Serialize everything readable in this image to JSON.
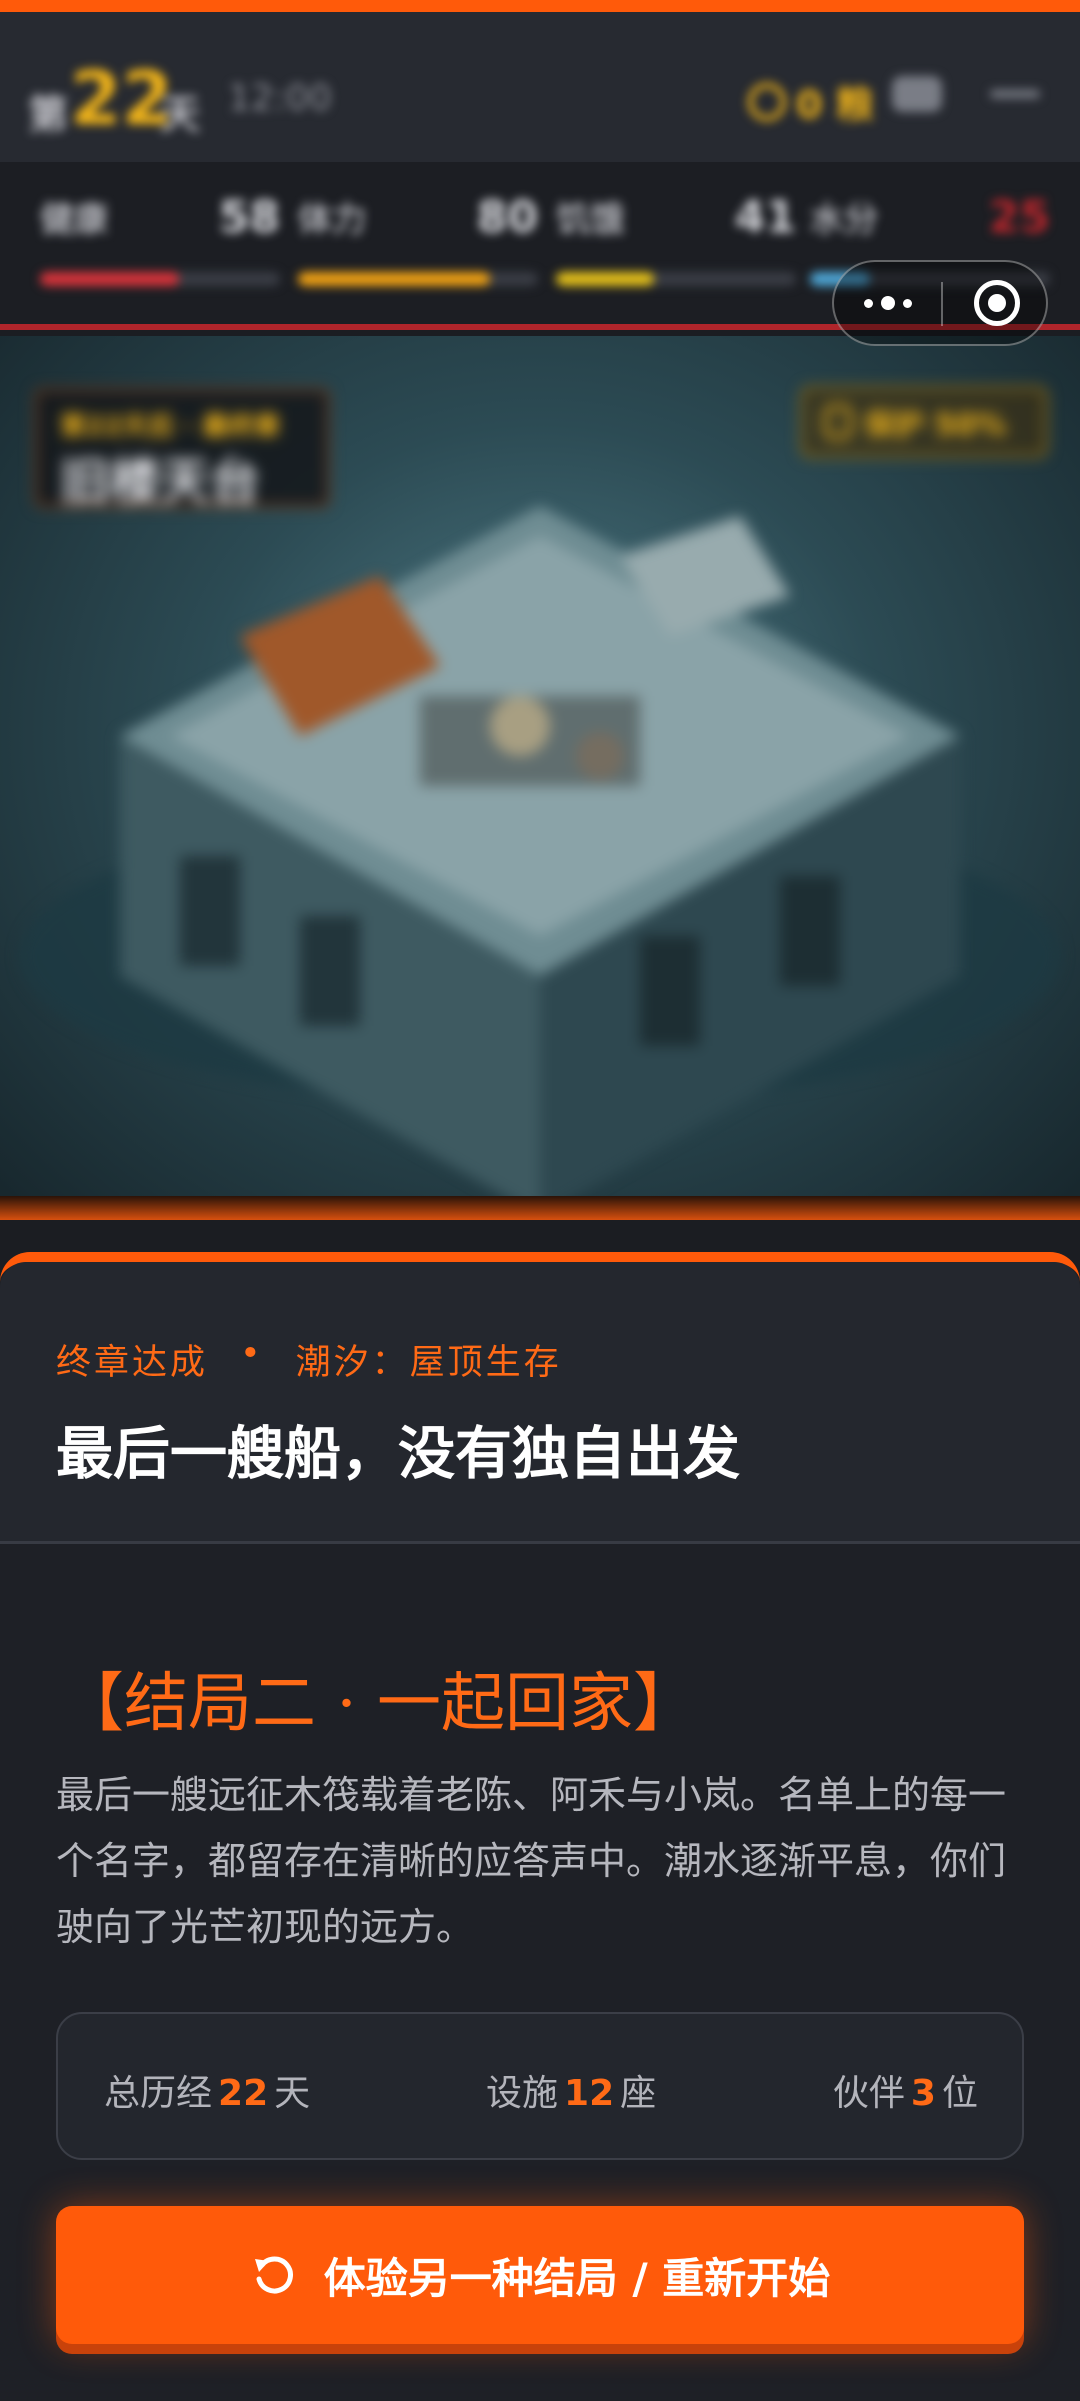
{
  "status_bar": {
    "day_prefix": "第",
    "day": "22",
    "day_suffix": "天",
    "time": "12:00",
    "gold": "0 粮"
  },
  "stats": [
    {
      "label": "健康",
      "value": "58",
      "fill": 0.58,
      "color": "#d8343b"
    },
    {
      "label": "体力",
      "value": "80",
      "fill": 0.8,
      "color": "#f2a314"
    },
    {
      "label": "饥饿",
      "value": "41",
      "fill": 0.41,
      "color": "#e6c21a"
    },
    {
      "label": "水分",
      "value": "25",
      "fill": 0.25,
      "color": "#4fa8d8"
    }
  ],
  "scene": {
    "location_sub": "第22天后 · 最终章",
    "location_title": "旧楼天台",
    "progress": "保护 50%"
  },
  "card": {
    "chapter": "终章达成",
    "mode": "潮汐：屋顶生存",
    "headline": "最后一艘船，没有独自出发",
    "ending_title": "【结局二 · 一起回家】",
    "ending_body": "最后一艘远征木筏载着老陈、阿禾与小岚。名单上的每一个名字，都留存在清晰的应答声中。潮水逐渐平息，你们驶向了光芒初现的远方。",
    "summary": {
      "days_prefix": "总历经",
      "days": "22",
      "days_unit": "天",
      "facilities_prefix": "设施",
      "facilities": "12",
      "facilities_unit": "座",
      "partners_prefix": "伙伴",
      "partners": "3",
      "partners_unit": "位"
    },
    "restart_label": "体验另一种结局 / 重新开始"
  },
  "colors": {
    "accent": "#ff5a0a",
    "accent_text": "#ff6a16",
    "gold": "#f2b51a",
    "background": "#1b1d22"
  },
  "icons": {
    "restart": "restart-icon",
    "more": "more-dots-icon",
    "close": "capsule-close-icon"
  }
}
